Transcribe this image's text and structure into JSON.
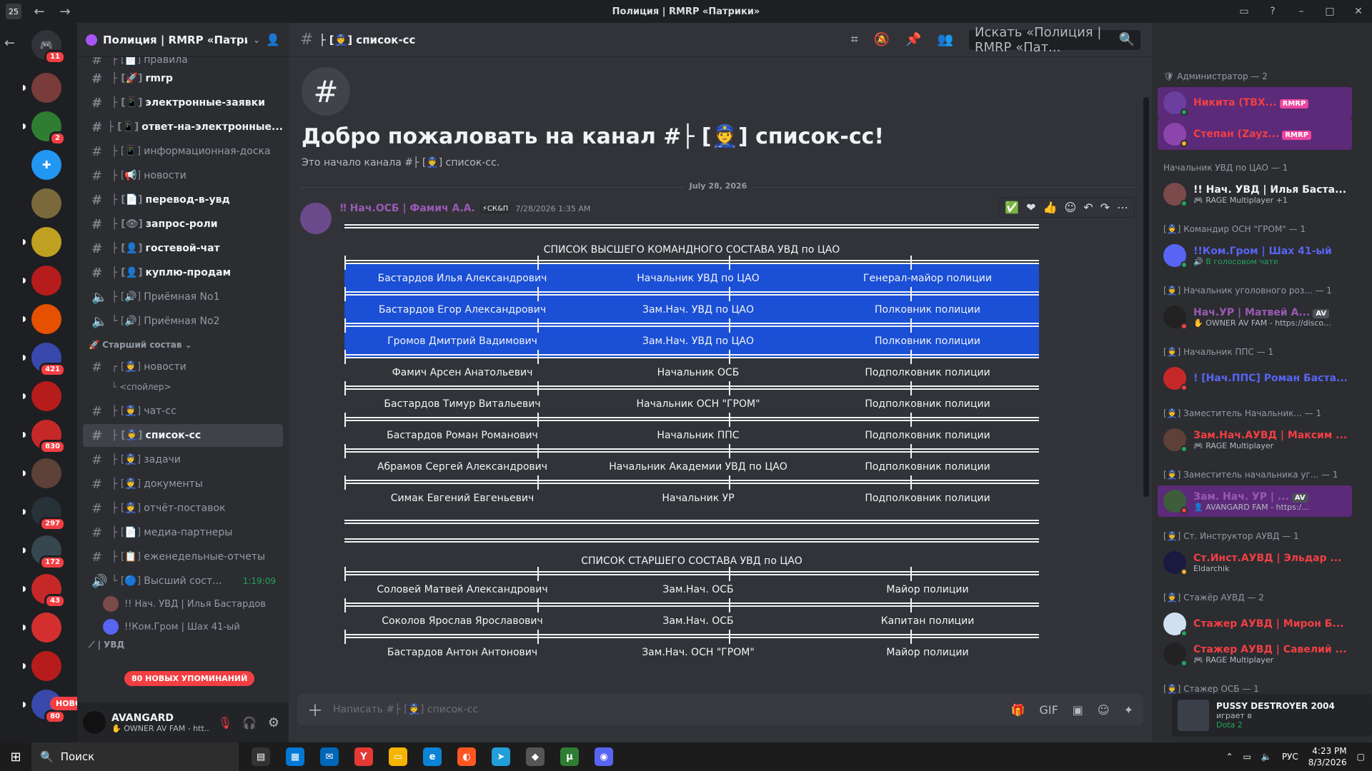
{
  "window": {
    "title": "Полиция | RMRP «Патрики»",
    "app_badge": "25"
  },
  "servers": {
    "home_badge": "11",
    "badges": [
      "2",
      "421",
      "830",
      "297",
      "172",
      "43",
      "80"
    ],
    "new_label": "НОВОЕ"
  },
  "guild": {
    "name": "Полиция | RMRP «Патри..."
  },
  "channels": [
    {
      "name": "правила",
      "prefix": "├ [📄]",
      "unread": false
    },
    {
      "name": "rmrp",
      "prefix": "├ [🚀]",
      "unread": true
    },
    {
      "name": "электронные-заявки",
      "prefix": "├ [📱]",
      "unread": true
    },
    {
      "name": "ответ-на-электронные...",
      "prefix": "├ [📱]",
      "unread": true
    },
    {
      "name": "информационная-доска",
      "prefix": "├ [📱]",
      "unread": false
    },
    {
      "name": "новости",
      "prefix": "├ [📢]",
      "unread": false
    },
    {
      "name": "перевод-в-увд",
      "prefix": "├ [📄]",
      "unread": true
    },
    {
      "name": "запрос-роли",
      "prefix": "├ [👁]",
      "unread": true
    },
    {
      "name": "гостевой-чат",
      "prefix": "├ [👤]",
      "unread": true
    },
    {
      "name": "куплю-продам",
      "prefix": "├ [👤]",
      "unread": true
    },
    {
      "name": "Приёмная No1",
      "prefix": "├ [🔊]",
      "unread": false
    },
    {
      "name": "Приёмная No2",
      "prefix": "└ [🔊]",
      "unread": false
    }
  ],
  "category": "Старший состав",
  "category2": "| УВД",
  "channels2": [
    {
      "name": "новости",
      "prefix": "┌ [👮]"
    },
    {
      "name": "<спойлер>",
      "prefix": "└"
    },
    {
      "name": "чат-сс",
      "prefix": "├ [👮]"
    },
    {
      "name": "список-сс",
      "prefix": "├ [👮]"
    },
    {
      "name": "задачи",
      "prefix": "├ [👮]"
    },
    {
      "name": "документы",
      "prefix": "├ [👮]"
    },
    {
      "name": "отчёт-поставок",
      "prefix": "├ [👮]"
    },
    {
      "name": "медиа-партнеры",
      "prefix": "├ [📄]"
    },
    {
      "name": "еженедельные-отчеты",
      "prefix": "├ [📋]"
    },
    {
      "name": "Высший сост...",
      "prefix": "└ [🔵]",
      "time": "1:19:09"
    }
  ],
  "voice_users": [
    {
      "name": "!! Нач. УВД | Илья Бастардов"
    },
    {
      "name": "!!Ком.Гром | Шах 41-ый"
    }
  ],
  "mentions_pill": "80 НОВЫХ УПОМИНАНИЙ",
  "user": {
    "name": "AVANGARD",
    "status": "✋ OWNER AV FAM - htt..."
  },
  "channel": {
    "name": "├ [👮] список-сс",
    "welcome_title": "Добро пожаловать на канал #├ [👮] список-сс!",
    "welcome_sub": "Это начало канала #├ [👮] список-сс.",
    "search_placeholder": "Искать «Полиция | RMRP «Пат...",
    "composer_placeholder": "Написать #├ [👮] список-сс"
  },
  "date_divider": "July 28, 2026",
  "message": {
    "author": "‼ Нач.ОСБ | Фамич А.А.",
    "tag": "⚡СК&П",
    "time": "7/28/2026 1:35 AM"
  },
  "table1": {
    "caption": "СПИСОК ВЫСШЕГО КОМАНДНОГО СОСТАВА УВД по ЦАО",
    "rows": [
      {
        "name": "Бастардов Илья Александрович",
        "position": "Начальник  УВД по ЦАО",
        "rank": "Генерал-майор полиции",
        "hl": true
      },
      {
        "name": "Бастардов Егор Александрович",
        "position": "Зам.Нач. УВД по ЦАО",
        "rank": "Полковник полиции",
        "hl": true
      },
      {
        "name": "Громов Дмитрий Вадимович",
        "position": "Зам.Нач. УВД по ЦАО",
        "rank": "Полковник полиции",
        "hl": true
      },
      {
        "name": "Фамич Арсен Анатольевич",
        "position": "Начальник ОСБ",
        "rank": "Подполковник полиции",
        "hl": false
      },
      {
        "name": "Бастардов Тимур  Витальевич",
        "position": "Начальник ОСН \"ГРОМ\"",
        "rank": "Подполковник полиции",
        "hl": false
      },
      {
        "name": "Бастардов Роман Романович",
        "position": "Начальник ППС",
        "rank": "Подполковник  полиции",
        "hl": false
      },
      {
        "name": "Абрамов Сергей Александрович",
        "position": "Начальник Академии УВД по ЦАО",
        "rank": "Подполковник полиции",
        "hl": false
      },
      {
        "name": "Симак Евгений Евгеньевич",
        "position": "Начальник УР",
        "rank": "Подполковник полиции",
        "hl": false
      }
    ]
  },
  "table2": {
    "caption": "СПИСОК СТАРШЕГО СОСТАВА УВД по ЦАО",
    "rows": [
      {
        "name": "Соловей Матвей Александрович",
        "position": "Зам.Нач. ОСБ",
        "rank": "Майор полиции"
      },
      {
        "name": "Соколов Ярослав Ярославович",
        "position": "Зам.Нач. ОСБ",
        "rank": "Капитан полиции"
      },
      {
        "name": "Бастардов Антон Антонович",
        "position": "Зам.Нач. ОСН \"ГРОМ\"",
        "rank": "Майор полиции"
      }
    ]
  },
  "members": {
    "groups": [
      "Администратор — 2",
      "Начальник УВД по ЦАО — 1",
      "[👮] Командир ОСН \"ГРОМ\" — 1",
      "[👮] Начальник уголовного роз... — 1",
      "[👮] Начальник ППС — 1",
      "[👮] Заместитель Начальник... — 1",
      "[👮] Заместитель начальника уг... — 1",
      "[👮] Ст. Инструктор АУВД — 1",
      "[👮] Стажёр АУВД — 2",
      "[👮] Стажер ОСБ — 1"
    ],
    "list": [
      {
        "name": "Никита (TBX...",
        "sub": "",
        "tag": "RMRP",
        "color": "#f23f43"
      },
      {
        "name": "Степан (Zayz...",
        "sub": "",
        "tag": "RMRP",
        "color": "#f23f43"
      },
      {
        "name": "!! Нач. УВД | Илья Баста...",
        "sub": "🎮 RAGE Multiplayer +1",
        "tag": "",
        "color": "#f2f3f5"
      },
      {
        "name": "!!Ком.Гром | Шах 41-ый",
        "sub": "🔊 В голосовом чате",
        "tag": "",
        "color": "#5865f2"
      },
      {
        "name": "Нач.УР | Матвей А...",
        "sub": "✋ OWNER AV FAM - https://disco...",
        "tag": "AV",
        "color": "#9b59b6"
      },
      {
        "name": "! [Нач.ППС] Роман Баста...",
        "sub": "",
        "tag": "",
        "color": "#5865f2"
      },
      {
        "name": "Зам.Нач.АУВД | Максим ...",
        "sub": "🎮 RAGE Multiplayer",
        "tag": "",
        "color": "#f23f43"
      },
      {
        "name": "Зам. Нач. УР | ...",
        "sub": "👤 AVANGARD FAM - https:/...",
        "tag": "AV",
        "color": "#9b59b6"
      },
      {
        "name": "Ст.Инст.АУВД | Эльдар ...",
        "sub": "Eldarchik",
        "tag": "",
        "color": "#f23f43"
      },
      {
        "name": "Стажер АУВД | Мирон Б...",
        "sub": "",
        "tag": "",
        "color": "#f23f43"
      },
      {
        "name": "Стажер АУВД | Савелий ...",
        "sub": "🎮 RAGE Multiplayer",
        "tag": "",
        "color": "#f23f43"
      }
    ]
  },
  "activity": {
    "name": "PUSSY DESTROYER 2004",
    "playing": "играет в",
    "game": "Dota 2"
  },
  "taskbar": {
    "search": "Поиск",
    "lang": "РУС",
    "time": "4:23 PM",
    "date": "8/3/2026"
  }
}
